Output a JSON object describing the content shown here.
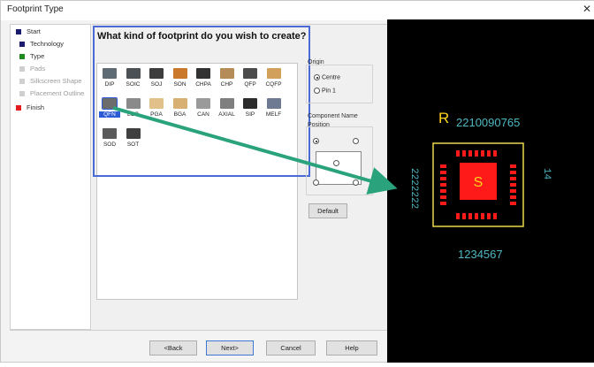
{
  "window": {
    "title": "Footprint Type"
  },
  "steps": [
    {
      "label": "Start",
      "color": "#1a1a6e",
      "state": "done"
    },
    {
      "label": "Technology",
      "color": "#1a1a6e",
      "state": "done"
    },
    {
      "label": "Type",
      "color": "#1f8a1f",
      "state": "current"
    },
    {
      "label": "Pads",
      "color": "#cfcfcf",
      "state": "pending"
    },
    {
      "label": "Silkscreen Shape",
      "color": "#cfcfcf",
      "state": "pending"
    },
    {
      "label": "Placement Outline",
      "color": "#cfcfcf",
      "state": "pending"
    },
    {
      "label": "Finish",
      "color": "#e11d1d",
      "state": "pending"
    }
  ],
  "question": "What kind of footprint do you wish to create?",
  "footprints": [
    {
      "label": "DIP",
      "icon": "dip-package-icon",
      "color": "#5e6b74",
      "selected": false
    },
    {
      "label": "SOIC",
      "icon": "soic-package-icon",
      "color": "#4b5154",
      "selected": false
    },
    {
      "label": "SOJ",
      "icon": "soj-package-icon",
      "color": "#3d3d3d",
      "selected": false
    },
    {
      "label": "SON",
      "icon": "son-package-icon",
      "color": "#c9782c",
      "selected": false
    },
    {
      "label": "CHPA",
      "icon": "chpa-package-icon",
      "color": "#333333",
      "selected": false
    },
    {
      "label": "CHP",
      "icon": "chp-package-icon",
      "color": "#b58b57",
      "selected": false
    },
    {
      "label": "QFP",
      "icon": "qfp-package-icon",
      "color": "#4c4c4c",
      "selected": false
    },
    {
      "label": "CQFP",
      "icon": "cqfp-package-icon",
      "color": "#d1a05a",
      "selected": false
    },
    {
      "label": "QFN",
      "icon": "qfn-package-icon",
      "color": "#6c6c6c",
      "selected": true
    },
    {
      "label": "LCC",
      "icon": "lcc-package-icon",
      "color": "#8a8a8a",
      "selected": false
    },
    {
      "label": "PGA",
      "icon": "pga-package-icon",
      "color": "#e1c08a",
      "selected": false
    },
    {
      "label": "BGA",
      "icon": "bga-package-icon",
      "color": "#d8b073",
      "selected": false
    },
    {
      "label": "CAN",
      "icon": "can-package-icon",
      "color": "#9a9a9a",
      "selected": false
    },
    {
      "label": "AXIAL",
      "icon": "axial-package-icon",
      "color": "#7f7f7f",
      "selected": false
    },
    {
      "label": "SIP",
      "icon": "sip-package-icon",
      "color": "#2d2d2d",
      "selected": false
    },
    {
      "label": "MELF",
      "icon": "melf-package-icon",
      "color": "#6e7a92",
      "selected": false
    },
    {
      "label": "SOD",
      "icon": "sod-package-icon",
      "color": "#5a5a5a",
      "selected": false
    },
    {
      "label": "SOT",
      "icon": "sot-package-icon",
      "color": "#3f3f3f",
      "selected": false
    }
  ],
  "origin": {
    "label": "Origin",
    "options": [
      {
        "label": "Centre",
        "checked": true
      },
      {
        "label": "Pin 1",
        "checked": false
      }
    ]
  },
  "component_name": {
    "label": "Component Name Position",
    "default_button": "Default"
  },
  "buttons": {
    "back": "<Back",
    "next": "Next>",
    "cancel": "Cancel",
    "help": "Help"
  },
  "preview": {
    "designator": "R",
    "center_label": "S",
    "top_numbers": "2210090765",
    "bottom_numbers": "1234567",
    "left_numbers": "2222222",
    "right_numbers": "14",
    "colors": {
      "silk": "#ffd21a",
      "pad": "#ff1a1a",
      "outline": "#e8d84a",
      "text": "#4fb7c3"
    }
  },
  "annotation": {
    "arrow_color": "#2aa37d"
  }
}
